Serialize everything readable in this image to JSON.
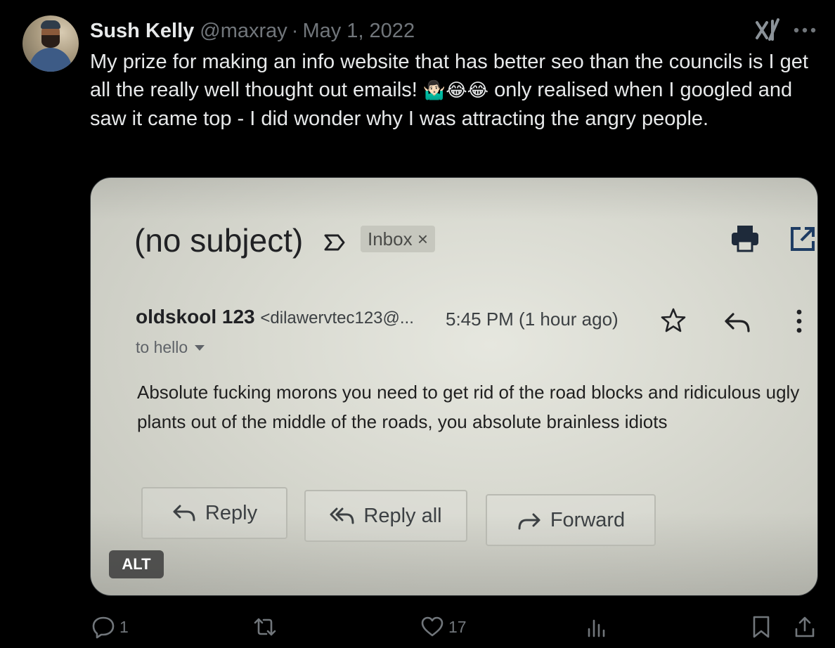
{
  "tweet": {
    "author_name": "Sush Kelly",
    "handle": "@maxray",
    "separator": "·",
    "date": "May 1, 2022",
    "text_before_emoji": "My prize for making an info website that has better seo than the councils is I get all the really well thought out emails! ",
    "emoji": "🤷🏻‍♂️😂😂",
    "text_after_emoji": " only realised when I googled and saw it came top - I did wonder why I was attracting the angry people."
  },
  "email": {
    "subject": "(no subject)",
    "inbox_chip": "Inbox ×",
    "sender_name": "oldskool 123",
    "sender_email": "<dilawervtec123@...",
    "time": "5:45 PM (1 hour ago)",
    "to_line": "to hello",
    "body": "Absolute fucking morons you need to get rid of the road blocks and ridiculous ugly plants out of the middle of the roads, you absolute brainless idiots",
    "buttons": {
      "reply": "Reply",
      "reply_all": "Reply all",
      "forward": "Forward"
    }
  },
  "media": {
    "alt_badge": "ALT"
  },
  "actions": {
    "replies": "1",
    "retweets": "",
    "likes": "17",
    "views": ""
  },
  "icons": {
    "grok": "grok-icon",
    "more": "more-icon",
    "reply": "reply-icon",
    "retweet": "retweet-icon",
    "like": "heart-icon",
    "views": "views-icon",
    "bookmark": "bookmark-icon",
    "share": "share-icon"
  },
  "colors": {
    "background": "#000000",
    "text_primary": "#e7e9ea",
    "text_secondary": "#71767b"
  }
}
